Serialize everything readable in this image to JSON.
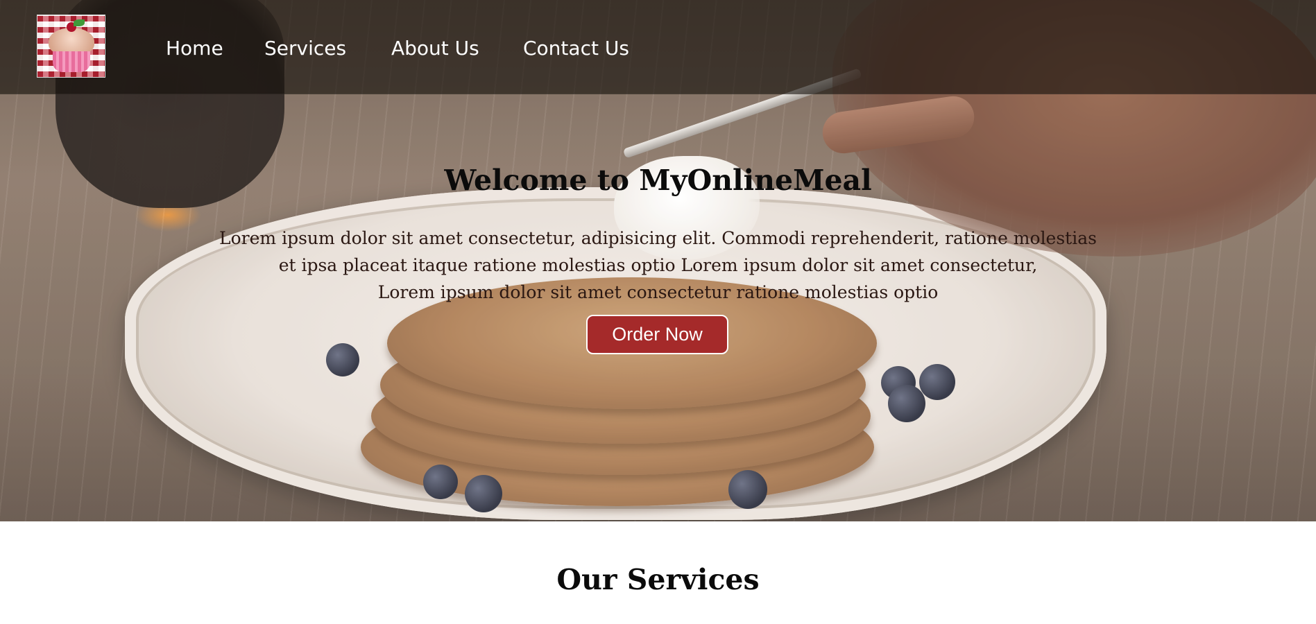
{
  "nav": {
    "logo_alt": "cupcake logo",
    "links": [
      "Home",
      "Services",
      "About Us",
      "Contact Us"
    ]
  },
  "hero": {
    "title": "Welcome to MyOnlineMeal",
    "text_lines": [
      "Lorem ipsum dolor sit amet consectetur, adipisicing elit. Commodi reprehenderit, ratione molestias",
      "et ipsa placeat itaque ratione molestias optio Lorem ipsum dolor sit amet consectetur,",
      "Lorem ipsum dolor sit amet consectetur ratione molestias optio"
    ],
    "button_label": "Order Now"
  },
  "services": {
    "title": "Our Services"
  },
  "colors": {
    "button_bg": "#a52a2a",
    "nav_bg": "#140e0a",
    "heading_text": "#0b0b0b"
  }
}
